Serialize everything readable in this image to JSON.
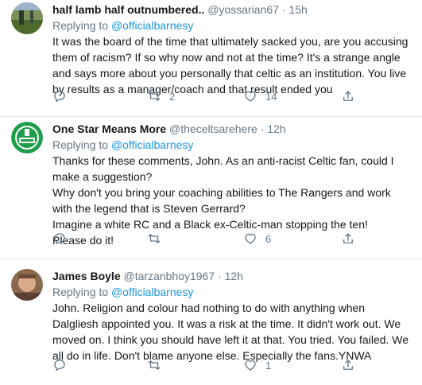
{
  "tweets": [
    {
      "name": "half lamb half outnumbered..",
      "handle": "@yossarian67",
      "time": "15h",
      "replying_prefix": "Replying to ",
      "replying_to": "@officialbarnesy",
      "body": [
        "It was the board of the time that ultimately sacked you, are you accusing them of racism? If so why now and not at the time? It's a strange angle and says more about you personally that celtic as an institution. You live by results as a manager/coach and that result ended you"
      ],
      "counts": {
        "replies": "",
        "retweets": "2",
        "likes": "14"
      }
    },
    {
      "name": "One Star Means More",
      "handle": "@theceltsarehere",
      "time": "12h",
      "replying_prefix": "Replying to ",
      "replying_to": "@officialbarnesy",
      "body": [
        "Thanks for these comments, John. As an anti-racist Celtic fan, could I make a suggestion?",
        "Why don't you bring your coaching abilities to The Rangers and work with the legend that is Steven Gerrard?",
        "Imagine a white RC and a Black ex-Celtic-man stopping the ten!",
        "Please do it!"
      ],
      "counts": {
        "replies": "",
        "retweets": "",
        "likes": "6"
      }
    },
    {
      "name": "James Boyle",
      "handle": "@tarzanbhoy1967",
      "time": "12h",
      "replying_prefix": "Replying to ",
      "replying_to": "@officialbarnesy",
      "body": [
        "John. Religion and colour had nothing to do with anything when Dalgliesh appointed you. It was a risk at the time. It didn't work out. We moved on. I think you should have left it at that. You tried. You failed. We all do in life. Don't blame anyone else. Especially the fans.YNWA"
      ],
      "counts": {
        "replies": "",
        "retweets": "",
        "likes": "1"
      }
    }
  ],
  "separator": "·",
  "icons": [
    "reply-icon",
    "retweet-icon",
    "like-icon",
    "share-icon"
  ],
  "colors": {
    "link": "#1b95e0",
    "muted": "#657786",
    "text": "#14171a",
    "divider": "#e6ecf0"
  }
}
